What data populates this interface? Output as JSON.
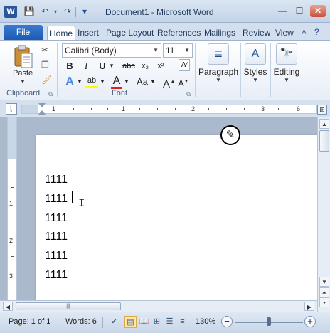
{
  "window": {
    "title": "Document1 - Microsoft Word",
    "app_icon": "W",
    "controls": {
      "minimize": "—",
      "maximize": "☐",
      "close": "✕"
    }
  },
  "quick_access": {
    "save": "💾",
    "undo": "↶",
    "redo": "↷",
    "customize": "▾"
  },
  "tabs": {
    "file": "File",
    "items": [
      "Home",
      "Insert",
      "Page Layout",
      "References",
      "Mailings",
      "Review",
      "View"
    ],
    "active": "Home"
  },
  "ribbon": {
    "clipboard": {
      "label": "Clipboard",
      "paste": "Paste"
    },
    "font": {
      "label": "Font",
      "font_name": "Calibri (Body)",
      "font_size": "11",
      "bold": "B",
      "italic": "I",
      "underline": "U",
      "strikethrough": "abc",
      "subscript": "x₂",
      "superscript": "x²",
      "grow": "A",
      "shrink": "A",
      "change_case": "Aa",
      "font_color": "A",
      "highlight": "ab",
      "text_effects": "A",
      "clear_format": "A"
    },
    "paragraph": {
      "label": "Paragraph"
    },
    "styles": {
      "label": "Styles"
    },
    "editing": {
      "label": "Editing"
    }
  },
  "ruler": {
    "numbers": [
      "1",
      "1",
      "2",
      "3",
      "4",
      "5",
      "6"
    ]
  },
  "vruler": {
    "numbers": [
      "1",
      "1",
      "2",
      "3"
    ]
  },
  "document": {
    "lines": [
      "1111",
      "1111",
      "1111",
      "1111",
      "1111",
      "1111"
    ]
  },
  "status": {
    "page": "Page: 1 of 1",
    "words": "Words: 6",
    "zoom": "130%"
  },
  "colors": {
    "file_tab": "#1c5bb5",
    "font_color_underline": "#e02020",
    "highlight_color": "#ffff00"
  }
}
